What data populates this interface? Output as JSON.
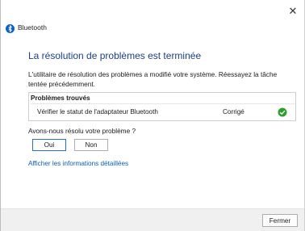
{
  "window": {
    "title": "Bluetooth",
    "close_glyph": "✕"
  },
  "content": {
    "heading": "La résolution de problèmes est terminée",
    "description": "L'utilitaire de résolution des problèmes a modifié votre système. Réessayez la tâche tentée précédemment.",
    "problems_header": "Problèmes trouvés",
    "problems": [
      {
        "name": "Vérifier le statut de l'adaptateur Bluetooth",
        "status": "Corrigé",
        "icon": "check-circle-icon"
      }
    ],
    "question": "Avons-nous résolu votre problème ?",
    "yes_label": "Oui",
    "no_label": "Non",
    "details_link": "Afficher les informations détaillées"
  },
  "footer": {
    "close_label": "Fermer"
  },
  "colors": {
    "heading": "#1a3f8c",
    "link": "#0b5fb5",
    "success": "#2aa12a",
    "bluetooth": "#0a62c9"
  }
}
